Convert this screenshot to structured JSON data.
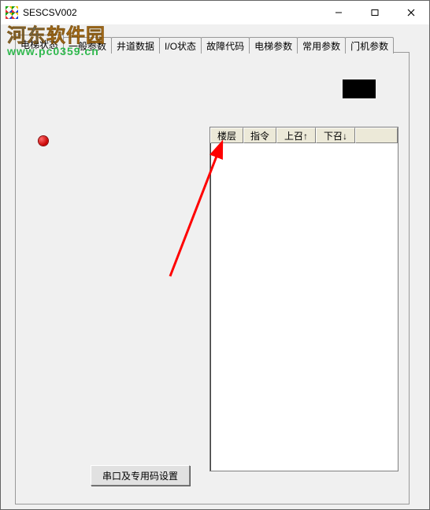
{
  "window": {
    "title": "SESCSV002"
  },
  "watermark": {
    "line1_a": "河东",
    "line1_b": "软件园",
    "line2": "www.pc0359.cn"
  },
  "tabs": [
    {
      "label": "电梯状态",
      "active": true
    },
    {
      "label": "一般参数",
      "active": false
    },
    {
      "label": "井道数据",
      "active": false
    },
    {
      "label": "I/O状态",
      "active": false
    },
    {
      "label": "故障代码",
      "active": false
    },
    {
      "label": "电梯参数",
      "active": false
    },
    {
      "label": "常用参数",
      "active": false
    },
    {
      "label": "门机参数",
      "active": false
    }
  ],
  "table": {
    "columns": [
      {
        "label": "楼层"
      },
      {
        "label": "指令"
      },
      {
        "label": "上召↑"
      },
      {
        "label": "下召↓"
      },
      {
        "label": ""
      }
    ],
    "rows": []
  },
  "button": {
    "serial_settings_label": "串口及专用码设置"
  },
  "colors": {
    "indicator": "#c80000",
    "arrow": "#ff0000"
  }
}
